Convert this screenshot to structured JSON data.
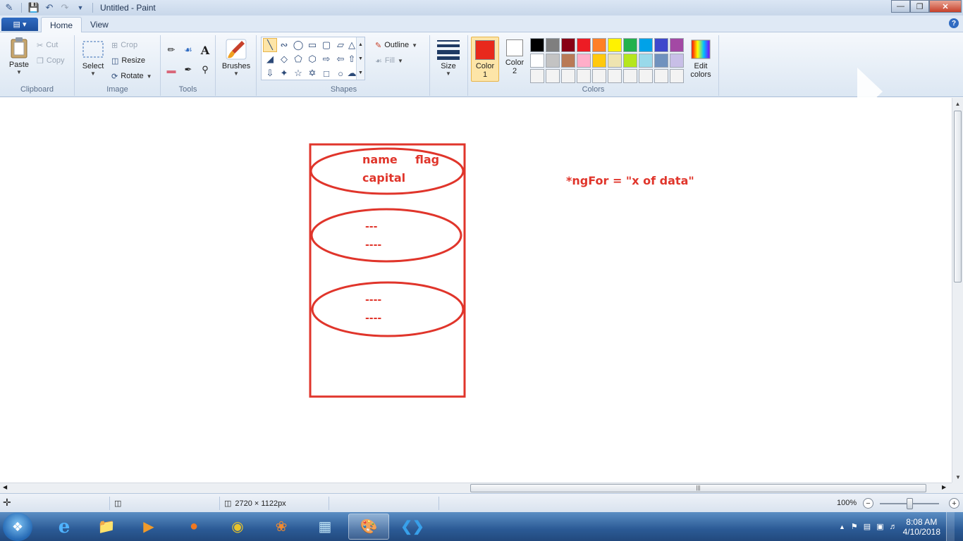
{
  "window": {
    "title": "Untitled - Paint"
  },
  "tabs": {
    "file_label": "▤ ▾",
    "home": "Home",
    "view": "View",
    "help": "?"
  },
  "clipboard": {
    "paste": "Paste",
    "cut": "Cut",
    "copy": "Copy",
    "label": "Clipboard"
  },
  "image": {
    "select": "Select",
    "crop": "Crop",
    "resize": "Resize",
    "rotate": "Rotate",
    "label": "Image"
  },
  "tools": {
    "label": "Tools",
    "text_tool": "A"
  },
  "brushes": {
    "label": "Brushes"
  },
  "shapes": {
    "outline": "Outline",
    "fill": "Fill",
    "label": "Shapes"
  },
  "size": {
    "label": "Size"
  },
  "colors": {
    "color1_label": "Color",
    "color1_num": "1",
    "color2_label": "Color",
    "color2_num": "2",
    "edit_label": "Edit",
    "edit_label2": "colors",
    "label": "Colors",
    "color1": "#e8291c",
    "color2": "#ffffff",
    "palette": [
      "#000000",
      "#7f7f7f",
      "#880015",
      "#ed1c24",
      "#ff7f27",
      "#fff200",
      "#22b14c",
      "#00a2e8",
      "#3f48cc",
      "#a349a4",
      "#ffffff",
      "#c3c3c3",
      "#b97a57",
      "#ffaec9",
      "#ffc90e",
      "#efe4b0",
      "#b5e61d",
      "#99d9ea",
      "#7092be",
      "#c8bfe7",
      "#f3f3f3",
      "#f3f3f3",
      "#f3f3f3",
      "#f3f3f3",
      "#f3f3f3",
      "#f3f3f3",
      "#f3f3f3",
      "#f3f3f3",
      "#f3f3f3",
      "#f3f3f3"
    ]
  },
  "canvas": {
    "ink_color": "#e0352b",
    "item1": {
      "name": "name",
      "flag": "flag",
      "capital": "capital"
    },
    "item2": {
      "line1": "---",
      "line2": "----"
    },
    "item3": {
      "line1": "----",
      "line2": "----"
    },
    "annotation": "*ngFor = \"x of data\""
  },
  "status": {
    "dimensions": "2720 × 1122px",
    "zoom": "100%"
  },
  "taskbar": {
    "time": "8:08 AM",
    "date": "4/10/2018"
  }
}
